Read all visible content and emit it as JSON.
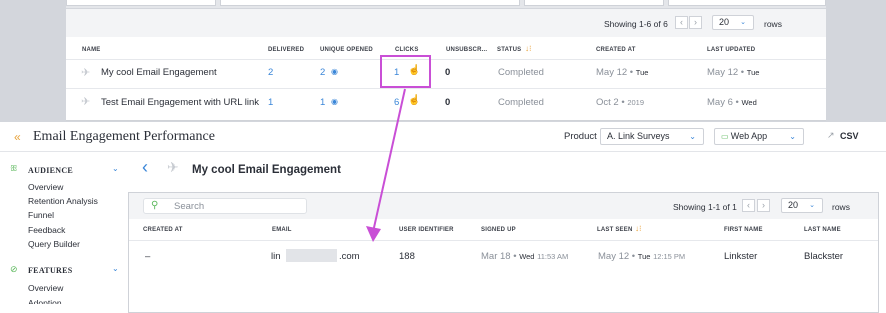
{
  "top_table": {
    "showing": "Showing 1-6 of 6",
    "page_size": "20",
    "rows_label": "rows",
    "columns": [
      "NAME",
      "DELIVERED",
      "UNIQUE OPENED",
      "CLICKS",
      "UNSUBSCR...",
      "STATUS",
      "CREATED AT",
      "LAST UPDATED"
    ],
    "rows": [
      {
        "name": "My cool Email Engagement",
        "delivered": "2",
        "opened": "2",
        "clicks": "1",
        "unsub": "0",
        "status": "Completed",
        "created": "May 12",
        "created_day": "Tue",
        "updated": "May 12",
        "updated_day": "Tue"
      },
      {
        "name": "Test Email Engagement with URL link",
        "delivered": "1",
        "opened": "1",
        "clicks": "6",
        "unsub": "0",
        "status": "Completed",
        "created": "Oct 2",
        "created_day": "2019",
        "updated": "May 6",
        "updated_day": "Wed"
      }
    ]
  },
  "header": {
    "title": "Email Engagement Performance",
    "product_label": "Product",
    "product_value": "A. Link Surveys",
    "app_value": "Web App",
    "csv_label": "CSV"
  },
  "sidebar": {
    "audience_title": "AUDIENCE",
    "audience_items": [
      "Overview",
      "Retention Analysis",
      "Funnel",
      "Feedback",
      "Query Builder"
    ],
    "features_title": "FEATURES",
    "features_items": [
      "Overview",
      "Adoption"
    ]
  },
  "detail": {
    "title": "My cool Email Engagement",
    "search_placeholder": "Search",
    "showing": "Showing 1-1 of 1",
    "page_size": "20",
    "rows_label": "rows",
    "columns": [
      "CREATED AT",
      "EMAIL",
      "USER IDENTIFIER",
      "SIGNED UP",
      "LAST SEEN",
      "FIRST NAME",
      "LAST NAME"
    ],
    "row": {
      "created": "–",
      "email_prefix": "lin",
      "email_suffix": ".com",
      "user_id": "188",
      "signed_up": "Mar 18",
      "signed_up_day": "Wed",
      "signed_up_time": "11:53 AM",
      "last_seen": "May 12",
      "last_seen_day": "Tue",
      "last_seen_time": "12:15 PM",
      "first_name": "Linkster",
      "last_name": "Blackster"
    }
  },
  "colors": {
    "accent_blue": "#3a86d8",
    "highlight": "#c94fd6",
    "brand_orange": "#e8a23a",
    "green": "#5cb85c"
  }
}
